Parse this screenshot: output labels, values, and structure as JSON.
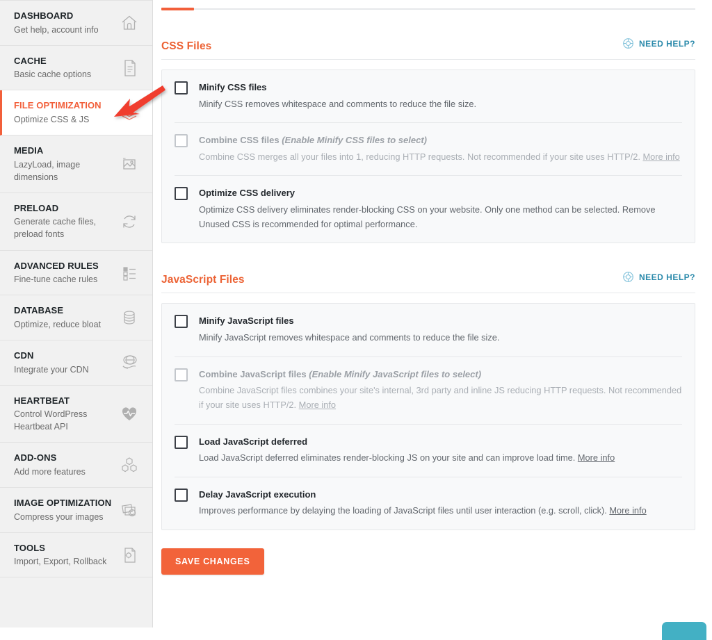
{
  "sidebar": {
    "items": [
      {
        "title": "DASHBOARD",
        "subtitle": "Get help, account info",
        "icon": "home-icon",
        "active": false
      },
      {
        "title": "CACHE",
        "subtitle": "Basic cache options",
        "icon": "document-icon",
        "active": false
      },
      {
        "title": "FILE OPTIMIZATION",
        "subtitle": "Optimize CSS & JS",
        "icon": "layers-icon",
        "active": true
      },
      {
        "title": "MEDIA",
        "subtitle": "LazyLoad, image dimensions",
        "icon": "image-icon",
        "active": false
      },
      {
        "title": "PRELOAD",
        "subtitle": "Generate cache files, preload fonts",
        "icon": "refresh-icon",
        "active": false
      },
      {
        "title": "ADVANCED RULES",
        "subtitle": "Fine-tune cache rules",
        "icon": "list-checkbox-icon",
        "active": false
      },
      {
        "title": "DATABASE",
        "subtitle": "Optimize, reduce bloat",
        "icon": "database-icon",
        "active": false
      },
      {
        "title": "CDN",
        "subtitle": "Integrate your CDN",
        "icon": "cdn-globe-icon",
        "active": false
      },
      {
        "title": "HEARTBEAT",
        "subtitle": "Control WordPress Heartbeat API",
        "icon": "heartbeat-icon",
        "active": false
      },
      {
        "title": "ADD-ONS",
        "subtitle": "Add more features",
        "icon": "blocks-icon",
        "active": false
      },
      {
        "title": "IMAGE OPTIMIZATION",
        "subtitle": "Compress your images",
        "icon": "photos-icon",
        "active": false
      },
      {
        "title": "TOOLS",
        "subtitle": "Import, Export, Rollback",
        "icon": "tools-file-icon",
        "active": false
      }
    ]
  },
  "main": {
    "sections": [
      {
        "title": "CSS Files",
        "help_label": "NEED HELP?",
        "help_icon": "lifebuoy-icon",
        "options": [
          {
            "label": "Minify CSS files",
            "hint": "",
            "description": "Minify CSS removes whitespace and comments to reduce the file size.",
            "link_text": "",
            "checked": false,
            "disabled": false
          },
          {
            "label": "Combine CSS files",
            "hint": "(Enable Minify CSS files to select)",
            "description": "Combine CSS merges all your files into 1, reducing HTTP requests. Not recommended if your site uses HTTP/2.",
            "link_text": "More info",
            "checked": false,
            "disabled": true
          },
          {
            "label": "Optimize CSS delivery",
            "hint": "",
            "description": "Optimize CSS delivery eliminates render-blocking CSS on your website. Only one method can be selected. Remove Unused CSS is recommended for optimal performance.",
            "link_text": "",
            "checked": false,
            "disabled": false
          }
        ]
      },
      {
        "title": "JavaScript Files",
        "help_label": "NEED HELP?",
        "help_icon": "lifebuoy-icon",
        "options": [
          {
            "label": "Minify JavaScript files",
            "hint": "",
            "description": "Minify JavaScript removes whitespace and comments to reduce the file size.",
            "link_text": "",
            "checked": false,
            "disabled": false
          },
          {
            "label": "Combine JavaScript files",
            "hint": "(Enable Minify JavaScript files to select)",
            "description": "Combine JavaScript files combines your site's internal, 3rd party and inline JS reducing HTTP requests. Not recommended if your site uses HTTP/2.",
            "link_text": "More info",
            "checked": false,
            "disabled": true
          },
          {
            "label": "Load JavaScript deferred",
            "hint": "",
            "description": "Load JavaScript deferred eliminates render-blocking JS on your site and can improve load time.",
            "link_text": "More info",
            "checked": false,
            "disabled": false
          },
          {
            "label": "Delay JavaScript execution",
            "hint": "",
            "description": "Improves performance by delaying the loading of JavaScript files until user interaction (e.g. scroll, click).",
            "link_text": "More info",
            "checked": false,
            "disabled": false
          }
        ]
      }
    ],
    "save_label": "SAVE CHANGES"
  },
  "annotation": {
    "arrow_color": "#f03c2e",
    "description": "red-arrow-pointing-to-file-optimization"
  },
  "chat_widget": {
    "color": "#43b0c4"
  },
  "colors": {
    "accent": "#ec6234",
    "save_button": "#f2633a",
    "help_link": "#2b8aab",
    "sidebar_bg": "#f1f1f1",
    "panel_bg": "#f8f9fa"
  }
}
